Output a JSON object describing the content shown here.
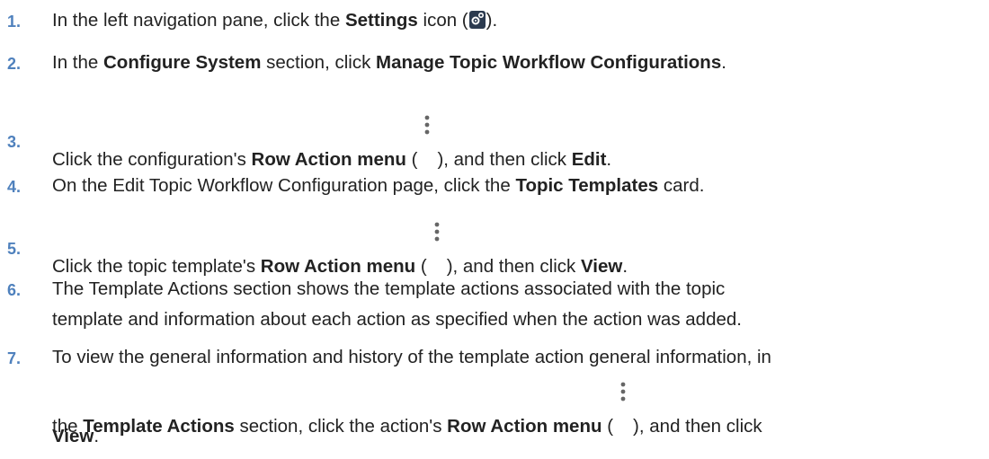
{
  "steps": [
    {
      "num": "1.",
      "parts": [
        "In the left navigation pane, click the ",
        "Settings",
        " icon (",
        ")."
      ]
    },
    {
      "num": "2.",
      "parts": [
        "In the ",
        "Configure System",
        " section, click ",
        "Manage Topic Workflow Configurations",
        "."
      ]
    },
    {
      "num": "3.",
      "parts": [
        "Click the configuration's ",
        "Row Action menu",
        " (",
        "), and then click ",
        "Edit",
        "."
      ]
    },
    {
      "num": "4.",
      "parts": [
        "On the Edit Topic Workflow Configuration page, click the ",
        "Topic Templates",
        " card."
      ]
    },
    {
      "num": "5.",
      "parts": [
        "Click the topic template's ",
        "Row Action menu",
        " (",
        "), and then click ",
        "View",
        "."
      ]
    },
    {
      "num": "6.",
      "lines": [
        "The Template Actions section shows the template actions associated with the topic",
        "template and information about each action as specified when the action was added."
      ]
    },
    {
      "num": "7.",
      "line1": "To view the general information and history of the template action general information, in",
      "parts": [
        "the ",
        "Template Actions",
        " section, click the action's ",
        "Row Action menu",
        " (",
        "), and then click"
      ],
      "line3": "View",
      "line3_end": "."
    }
  ],
  "icons": {
    "settings": "settings-gear-icon",
    "row_action": "kebab-menu-icon"
  },
  "colors": {
    "step_number": "#4f81bd",
    "text": "#222222"
  }
}
